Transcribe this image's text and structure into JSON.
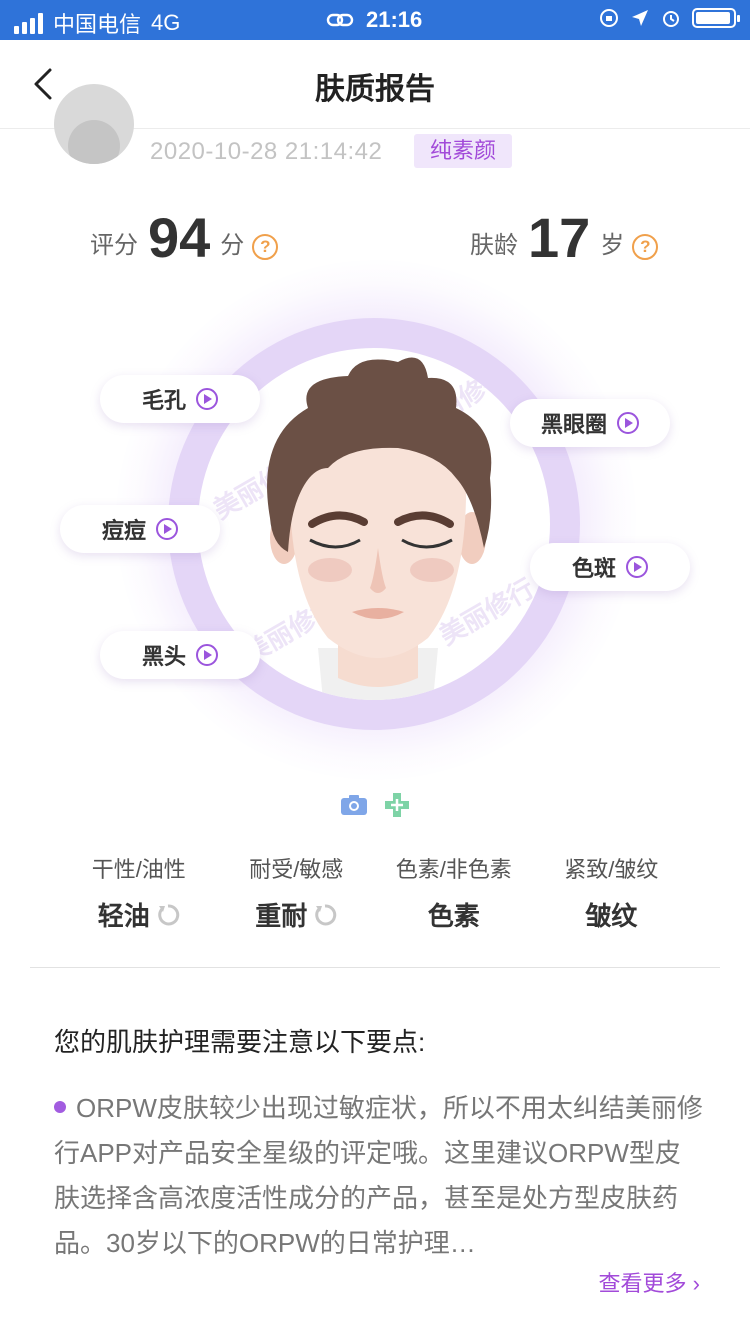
{
  "status_bar": {
    "carrier": "中国电信",
    "network": "4G",
    "time": "21:16"
  },
  "nav": {
    "title": "肤质报告"
  },
  "profile": {
    "datetime": "2020-10-28 21:14:42",
    "tag": "纯素颜"
  },
  "scores": {
    "score_label": "评分",
    "score_value": "94",
    "score_unit": "分",
    "age_label": "肤龄",
    "age_value": "17",
    "age_unit": "岁"
  },
  "face_tags": {
    "pores": "毛孔",
    "dark_circles": "黑眼圈",
    "acne": "痘痘",
    "spots": "色斑",
    "blackheads": "黑头"
  },
  "watermark": "美丽修行",
  "attributes": [
    {
      "label": "干性/油性",
      "value": "轻油"
    },
    {
      "label": "耐受/敏感",
      "value": "重耐"
    },
    {
      "label": "色素/非色素",
      "value": "色素"
    },
    {
      "label": "紧致/皱纹",
      "value": "皱纹"
    }
  ],
  "care": {
    "title": "您的肌肤护理需要注意以下要点:",
    "text": "ORPW皮肤较少出现过敏症状，所以不用太纠结美丽修行APP对产品安全星级的评定哦。这里建议ORPW型皮肤选择含高浓度活性成分的产品，甚至是处方型皮肤药品。30岁以下的ORPW的日常护理…",
    "more": "查看更多 ›"
  },
  "colors": {
    "status_bar": "#2f73d9",
    "accent_purple": "#a24ad9",
    "help_orange": "#f0a04b"
  }
}
